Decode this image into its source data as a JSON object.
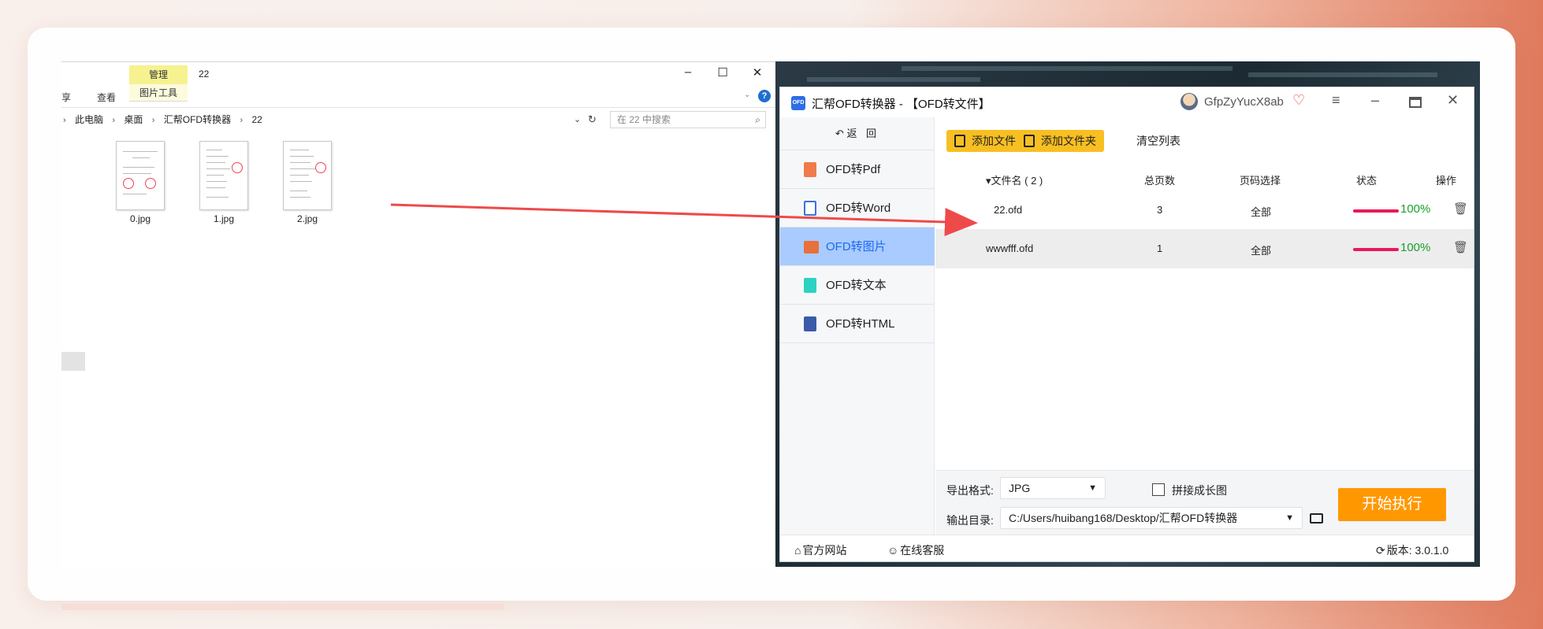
{
  "explorer": {
    "ribbon": {
      "manage_tab": "管理",
      "picture_tools_tab": "图片工具",
      "window_name": "22",
      "share_tab": "共享",
      "view_tab": "查看",
      "help_glyph": "?"
    },
    "address": {
      "crumbs": [
        "此电脑",
        "桌面",
        "汇帮OFD转换器",
        "22"
      ],
      "search_placeholder": "在 22 中搜索"
    },
    "files": [
      {
        "name": "0.jpg"
      },
      {
        "name": "1.jpg"
      },
      {
        "name": "2.jpg"
      }
    ]
  },
  "app": {
    "logo_text": "OFD",
    "title": "汇帮OFD转换器 - 【OFD转文件】",
    "username": "GfpZyYucX8ab",
    "back_label": "返 回",
    "nav": [
      {
        "label": "OFD转Pdf",
        "icon": "pdf-icon",
        "color": "#f07a4a",
        "active": false
      },
      {
        "label": "OFD转Word",
        "icon": "word-icon",
        "color": "#3b72d9",
        "active": false
      },
      {
        "label": "OFD转图片",
        "icon": "image-icon",
        "color": "#e8703a",
        "active": true
      },
      {
        "label": "OFD转文本",
        "icon": "text-icon",
        "color": "#2bd3c0",
        "active": false
      },
      {
        "label": "OFD转HTML",
        "icon": "html-icon",
        "color": "#3b5aa8",
        "active": false
      }
    ],
    "toolbar": {
      "add_file": "添加文件",
      "add_folder": "添加文件夹",
      "clear_list": "清空列表"
    },
    "table": {
      "headers": {
        "filename": "▾文件名 ( 2 )",
        "pages": "总页数",
        "page_select": "页码选择",
        "status": "状态",
        "actions": "操作"
      },
      "rows": [
        {
          "filename": "22.ofd",
          "pages": "3",
          "page_select": "全部",
          "progress": 1.0,
          "status": "100%"
        },
        {
          "filename": "wwwfff.ofd",
          "pages": "1",
          "page_select": "全部",
          "progress": 1.0,
          "status": "100%"
        }
      ]
    },
    "output": {
      "format_label": "导出格式:",
      "format_value": "JPG",
      "merge_label": "拼接成长图",
      "dir_label": "输出目录:",
      "dir_value": "C:/Users/huibang168/Desktop/汇帮OFD转换器",
      "start_label": "开始执行"
    },
    "footer": {
      "website": "官方网站",
      "support": "在线客服",
      "version": "版本: 3.0.1.0"
    },
    "colors": {
      "accent_yellow": "#f8bf22",
      "start_orange": "#ff9800",
      "active_nav_bg": "#a9cbff",
      "progress_red": "#e8195a",
      "status_green": "#19a12a"
    }
  }
}
